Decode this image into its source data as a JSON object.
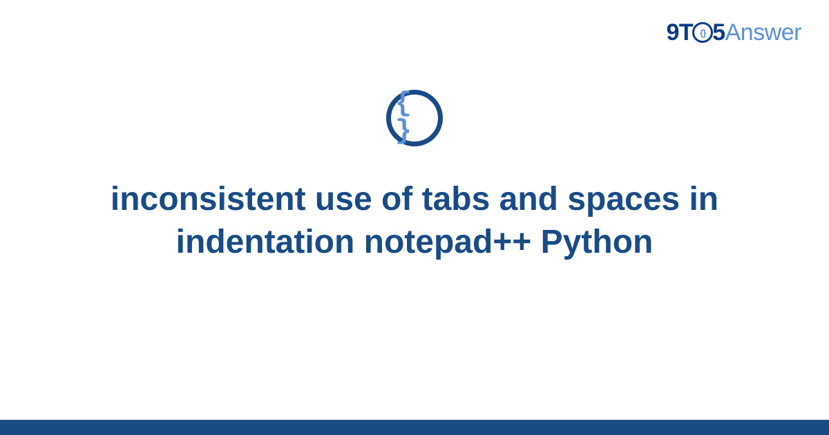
{
  "logo": {
    "part1": "9T",
    "circle_inner": "{}",
    "part2": "5",
    "part3": "Answer"
  },
  "icon": {
    "braces": "{ }"
  },
  "title": "inconsistent use of tabs and spaces in indentation notepad++ Python"
}
